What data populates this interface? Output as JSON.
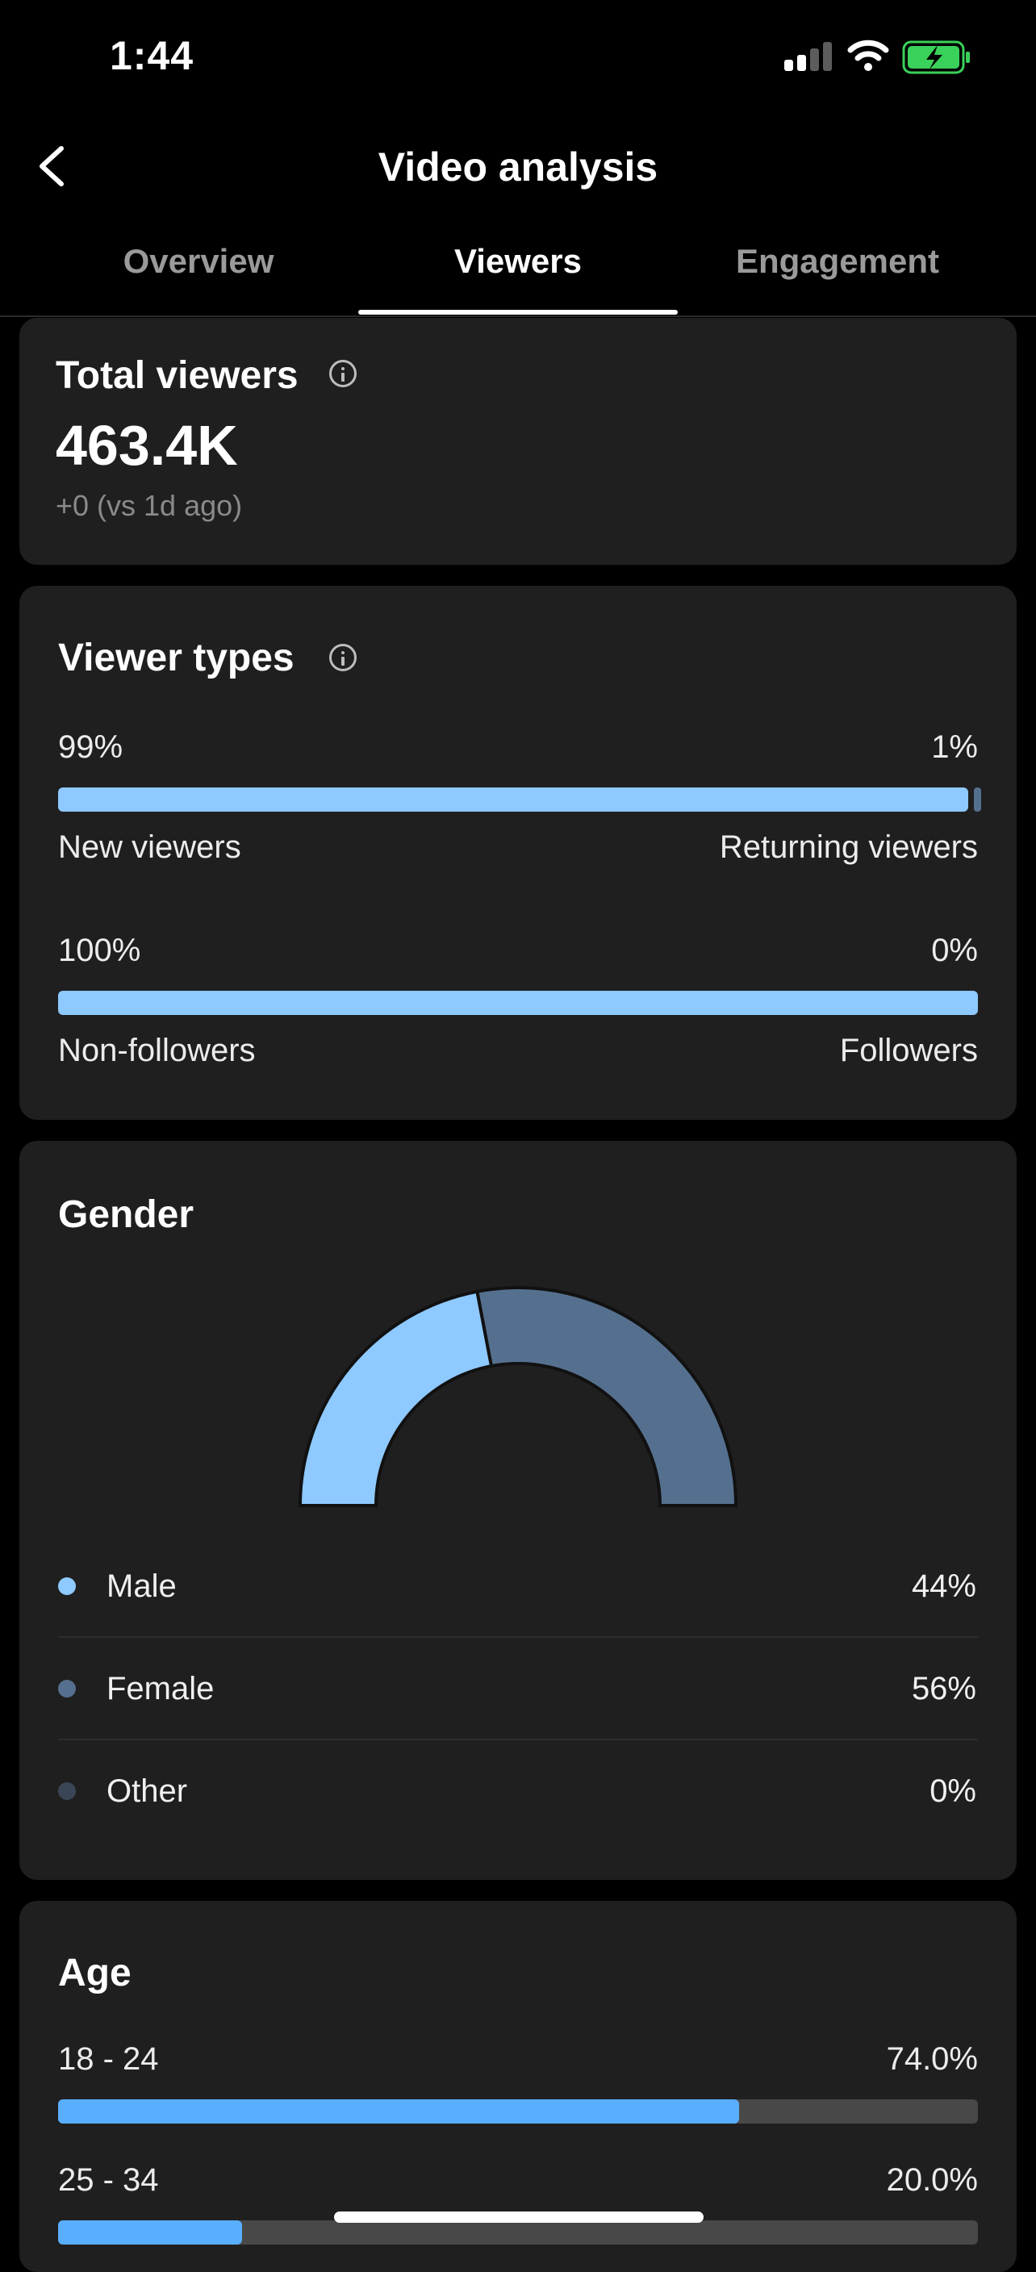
{
  "status_bar": {
    "time": "1:44"
  },
  "header": {
    "title": "Video analysis"
  },
  "tabs": [
    {
      "label": "Overview",
      "active": false
    },
    {
      "label": "Viewers",
      "active": true
    },
    {
      "label": "Engagement",
      "active": false
    }
  ],
  "total_viewers": {
    "title": "Total viewers",
    "value": "463.4K",
    "delta": "+0 (vs 1d ago)"
  },
  "viewer_types": {
    "title": "Viewer types",
    "rows": [
      {
        "left_pct": "99%",
        "right_pct": "1%",
        "left_label": "New viewers",
        "right_label": "Returning viewers",
        "fraction": 0.99
      },
      {
        "left_pct": "100%",
        "right_pct": "0%",
        "left_label": "Non-followers",
        "right_label": "Followers",
        "fraction": 1.0
      }
    ]
  },
  "gender": {
    "title": "Gender",
    "items": [
      {
        "label": "Male",
        "value": "44%",
        "color": "#8ec9ff"
      },
      {
        "label": "Female",
        "value": "56%",
        "color": "#55708f"
      },
      {
        "label": "Other",
        "value": "0%",
        "color": "#3a4656"
      }
    ]
  },
  "age": {
    "title": "Age",
    "rows": [
      {
        "label": "18 - 24",
        "value": "74.0%",
        "fraction": 0.74
      },
      {
        "label": "25 - 34",
        "value": "20.0%",
        "fraction": 0.2
      }
    ]
  },
  "colors": {
    "bar_fill": "#8ec9ff",
    "age_fill": "#5aaeff",
    "track": "#484848",
    "returning": "#55708f"
  },
  "chart_data": {
    "type": "pie",
    "title": "Gender",
    "categories": [
      "Male",
      "Female",
      "Other"
    ],
    "values": [
      44,
      56,
      0
    ]
  }
}
